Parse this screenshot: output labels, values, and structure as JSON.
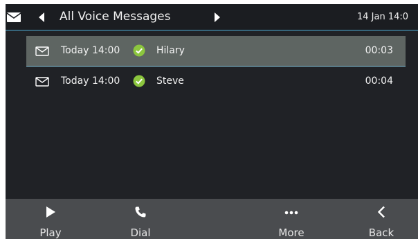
{
  "header": {
    "title": "All Voice Messages",
    "date_time": "14 Jan 14:0",
    "icons": [
      "mail-icon",
      "previous-arrow-icon",
      "next-arrow-icon"
    ]
  },
  "messages": [
    {
      "time": "Today 14:00",
      "name": "Hilary",
      "duration": "00:03",
      "status_icon": "check-icon",
      "selected": true
    },
    {
      "time": "Today 14:00",
      "name": "Steve",
      "duration": "00:04",
      "status_icon": "check-icon",
      "selected": false
    }
  ],
  "softkeys": [
    {
      "label": "Play",
      "icon": "play-icon"
    },
    {
      "label": "Dial",
      "icon": "phone-icon"
    },
    {
      "label": "More",
      "icon": "more-dots-icon"
    },
    {
      "label": "Back",
      "icon": "back-chevron-icon"
    }
  ],
  "colors": {
    "background": "#202226",
    "selected_row": "#5e6562",
    "accent_line": "#4fb0d9",
    "check_green": "#8cc63e",
    "softkey_bar": "#4a4c4f"
  }
}
